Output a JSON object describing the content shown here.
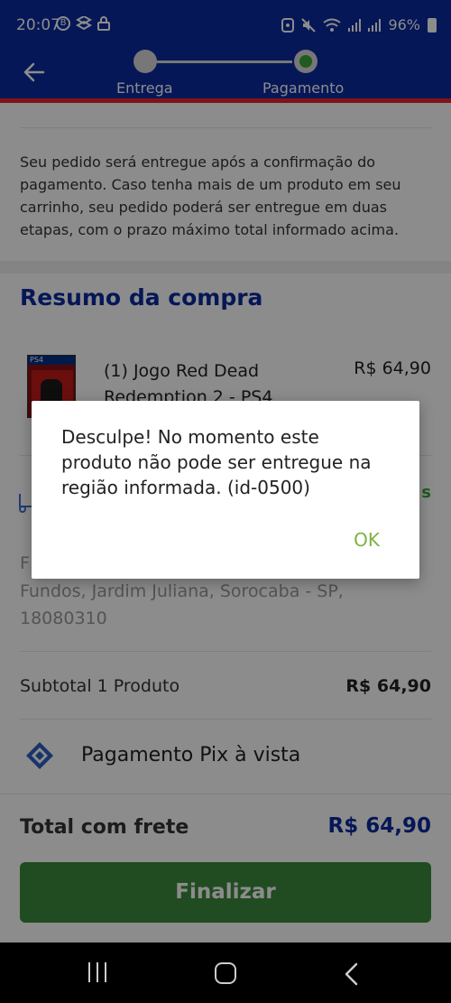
{
  "status_bar": {
    "time": "20:07",
    "battery": "96%",
    "left_icons": [
      "b-circle-icon",
      "dropbox-icon",
      "lock-icon"
    ],
    "right_icons": [
      "nfc-icon",
      "mute-icon",
      "wifi-icon",
      "signal-icon",
      "signal-icon",
      "battery-icon"
    ]
  },
  "header": {
    "steps": [
      {
        "label": "Entrega",
        "state": "done"
      },
      {
        "label": "Pagamento",
        "state": "active"
      }
    ],
    "colors": {
      "brand_blue": "#0a2a9e",
      "accent_red": "#e8262c",
      "step_green": "#3aa63a"
    }
  },
  "main": {
    "notice": "Seu pedido será entregue após a confirmação do pagamento. Caso tenha mais de um produto em seu carrinho, seu pedido poderá ser entregue em duas etapas, com o prazo máximo total informado acima.",
    "summary_title": "Resumo da compra",
    "product": {
      "name": "(1) Jogo Red Dead Redemption 2 - PS4",
      "price": "R$ 64,90",
      "platform": "PS4"
    },
    "delivery": {
      "right_text": "s",
      "address_line1": "F",
      "address": "Fundos, Jardim Juliana, Sorocaba - SP, 18080310"
    },
    "subtotal": {
      "label": "Subtotal 1 Produto",
      "value": "R$ 64,90"
    },
    "payment": {
      "label": "Pagamento Pix à vista"
    },
    "total": {
      "label": "Total com frete",
      "value": "R$ 64,90"
    },
    "finalize_label": "Finalizar"
  },
  "dialog": {
    "message": "Desculpe! No momento este produto não pode ser entregue na região informada. (id-0500)",
    "ok_label": "OK",
    "ok_color": "#7cb342"
  }
}
